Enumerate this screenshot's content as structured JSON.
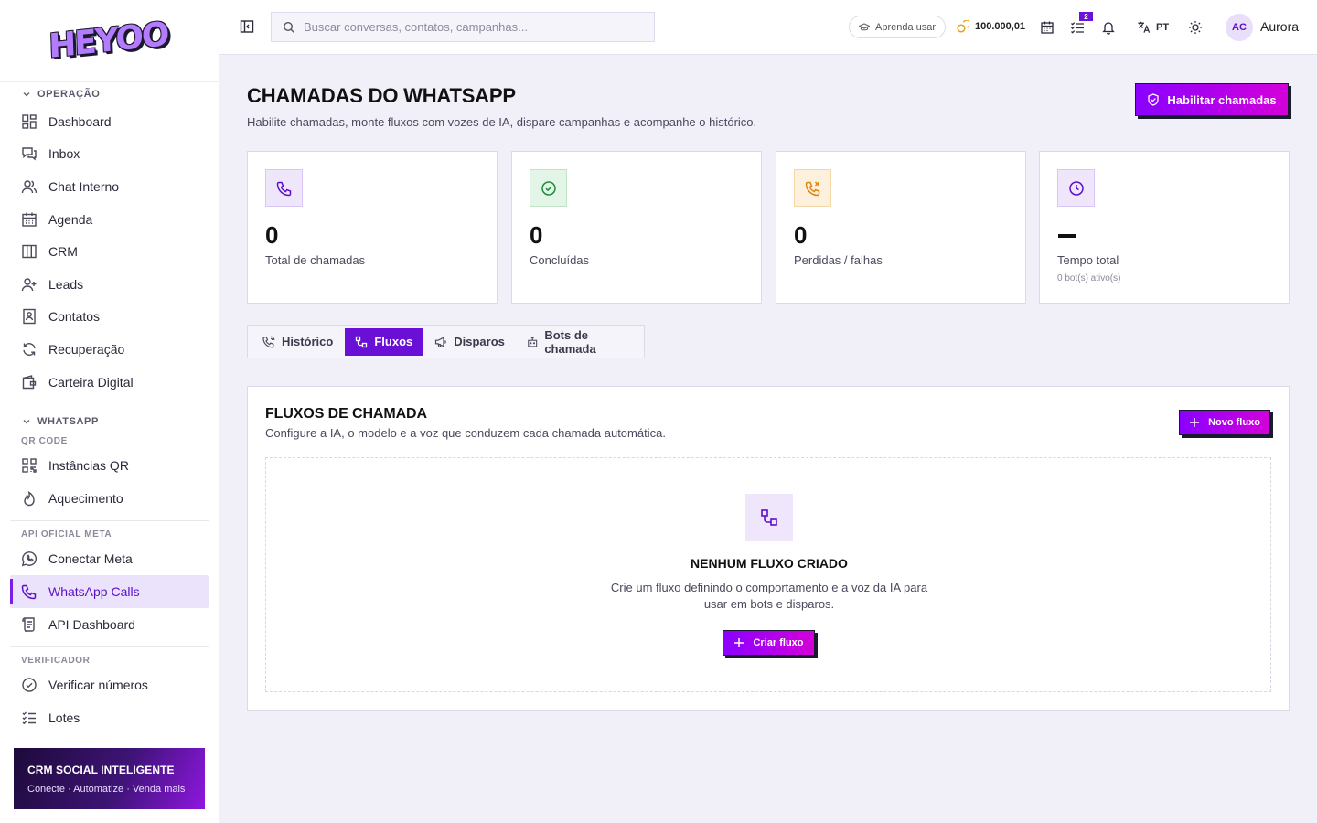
{
  "brand": {
    "logo_text": "HEYOO"
  },
  "sidebar": {
    "sections": [
      {
        "title": "OPERAÇÃO",
        "items": [
          {
            "label": "Dashboard"
          },
          {
            "label": "Inbox"
          },
          {
            "label": "Chat Interno"
          },
          {
            "label": "Agenda"
          },
          {
            "label": "CRM"
          },
          {
            "label": "Leads"
          },
          {
            "label": "Contatos"
          },
          {
            "label": "Recuperação"
          },
          {
            "label": "Carteira Digital"
          }
        ]
      },
      {
        "title": "WHATSAPP",
        "subtitle": "QR CODE",
        "items": [
          {
            "label": "Instâncias QR"
          },
          {
            "label": "Aquecimento"
          }
        ]
      },
      {
        "subtitle": "API OFICIAL META",
        "items": [
          {
            "label": "Conectar Meta"
          },
          {
            "label": "WhatsApp Calls",
            "active": true
          },
          {
            "label": "API Dashboard"
          }
        ]
      },
      {
        "subtitle": "VERIFICADOR",
        "items": [
          {
            "label": "Verificar números"
          },
          {
            "label": "Lotes"
          }
        ]
      }
    ],
    "promo": {
      "title": "CRM SOCIAL INTELIGENTE",
      "subtitle": "Conecte · Automatize · Venda mais"
    }
  },
  "topbar": {
    "search_placeholder": "Buscar conversas, contatos, campanhas...",
    "learn_label": "Aprenda usar",
    "coins": "100.000,01",
    "tasks_badge": "2",
    "language": "PT",
    "user_initials": "AC",
    "user_name": "Aurora"
  },
  "page": {
    "title": "CHAMADAS DO WHATSAPP",
    "subtitle": "Habilite chamadas, monte fluxos com vozes de IA, dispare campanhas e acompanhe o histórico.",
    "enable_button": "Habilitar chamadas"
  },
  "stats": [
    {
      "value": "0",
      "label": "Total de chamadas",
      "icon": "phone-icon"
    },
    {
      "value": "0",
      "label": "Concluídas",
      "icon": "check-circle-icon"
    },
    {
      "value": "0",
      "label": "Perdidas / falhas",
      "icon": "phone-missed-icon"
    },
    {
      "value": "",
      "label": "Tempo total",
      "note": "0 bot(s) ativo(s)",
      "icon": "clock-icon"
    }
  ],
  "tabs": [
    {
      "label": "Histórico",
      "icon": "phone-history-icon"
    },
    {
      "label": "Fluxos",
      "icon": "flow-icon",
      "active": true
    },
    {
      "label": "Disparos",
      "icon": "megaphone-icon"
    },
    {
      "label": "Bots de chamada",
      "icon": "bot-icon"
    }
  ],
  "flows": {
    "title": "FLUXOS DE CHAMADA",
    "subtitle": "Configure a IA, o modelo e a voz que conduzem cada chamada automática.",
    "new_button": "Novo fluxo",
    "empty_title": "NENHUM FLUXO CRIADO",
    "empty_text": "Crie um fluxo definindo o comportamento e a voz da IA para usar em bots e disparos.",
    "create_button": "Criar fluxo"
  },
  "colors": {
    "accent": "#6a10d6",
    "gradient_start": "#8a00ff",
    "gradient_end": "#d400d9"
  }
}
